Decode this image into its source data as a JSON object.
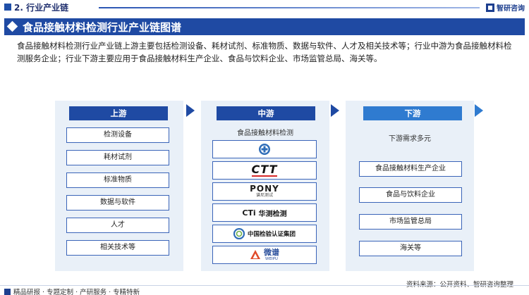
{
  "header": {
    "section_title": "2. 行业产业链",
    "brand_name": "智研咨询"
  },
  "banner": {
    "title": "食品接触材料检测行业产业链图谱"
  },
  "description": "食品接触材料检测行业产业链上游主要包括检测设备、耗材试剂、标准物质、数据与软件、人才及相关技术等；行业中游为食品接触材料检测服务企业；行业下游主要应用于食品接触材料生产企业、食品与饮料企业、市场监管总局、海关等。",
  "upstream": {
    "label": "上游",
    "items": [
      "检测设备",
      "耗材试剂",
      "标准物质",
      "数据与软件",
      "人才",
      "相关技术等"
    ]
  },
  "midstream": {
    "label": "中游",
    "subtitle": "食品接触材料检测",
    "logos": [
      {
        "icon": "circle-cross-logo",
        "text": ""
      },
      {
        "icon": "ctt-logo",
        "text": "CTT"
      },
      {
        "icon": "pony-logo",
        "text": "PONY",
        "sub": "谱尼测试"
      },
      {
        "icon": "cti-logo",
        "text": "CTi",
        "sub": "华测检测"
      },
      {
        "icon": "ccic-logo",
        "text": "中国检验认证集团"
      },
      {
        "icon": "weipu-logo",
        "text": "微谱",
        "sub": "WEIPU"
      }
    ]
  },
  "downstream": {
    "label": "下游",
    "subtitle": "下游需求多元",
    "items": [
      "食品接触材料生产企业",
      "食品与饮料企业",
      "市场监管总局",
      "海关等"
    ]
  },
  "footer": {
    "services": "精品研报 · 专题定制 · 产研服务 · 专精特新",
    "source": "资料来源：公开资料、智研咨询整理"
  },
  "colors": {
    "primary": "#1f4aa3",
    "downstream": "#2f7bd0",
    "panel": "#e9f0f8"
  }
}
